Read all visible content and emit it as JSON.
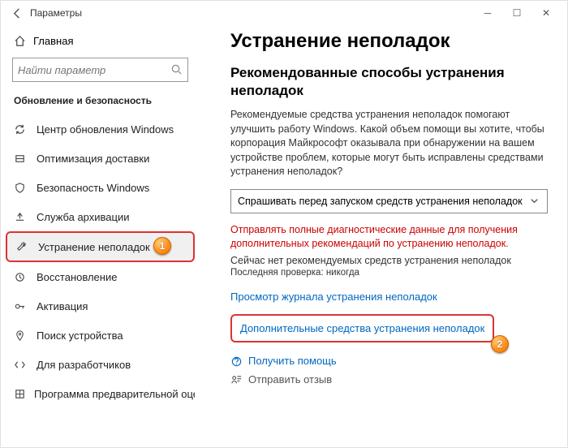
{
  "titlebar": {
    "title": "Параметры"
  },
  "home": {
    "label": "Главная"
  },
  "search": {
    "placeholder": "Найти параметр"
  },
  "section": {
    "title": "Обновление и безопасность"
  },
  "nav": {
    "items": [
      {
        "label": "Центр обновления Windows"
      },
      {
        "label": "Оптимизация доставки"
      },
      {
        "label": "Безопасность Windows"
      },
      {
        "label": "Служба архивации"
      },
      {
        "label": "Устранение неполадок"
      },
      {
        "label": "Восстановление"
      },
      {
        "label": "Активация"
      },
      {
        "label": "Поиск устройства"
      },
      {
        "label": "Для разработчиков"
      },
      {
        "label": "Программа предварительной оценки Windows"
      }
    ]
  },
  "main": {
    "title": "Устранение неполадок",
    "subtitle": "Рекомендованные способы устранения неполадок",
    "body": "Рекомендуемые средства устранения неполадок помогают улучшить работу Windows. Какой объем помощи вы хотите, чтобы корпорация Майкрософт оказывала при обнаружении на вашем устройстве проблем, которые могут быть исправлены средствами устранения неполадок?",
    "dropdown": "Спрашивать перед запуском средств устранения неполадок",
    "warning": "Отправлять полные диагностические данные для получения дополнительных рекомендаций по устранению неполадок.",
    "status1": "Сейчас нет рекомендуемых средств устранения неполадок",
    "status2": "Последняя проверка: никогда",
    "link_history": "Просмотр журнала устранения неполадок",
    "link_more": "Дополнительные средства устранения неполадок",
    "help_get": "Получить помощь",
    "help_feedback": "Отправить отзыв"
  },
  "badges": {
    "b1": "1",
    "b2": "2"
  }
}
